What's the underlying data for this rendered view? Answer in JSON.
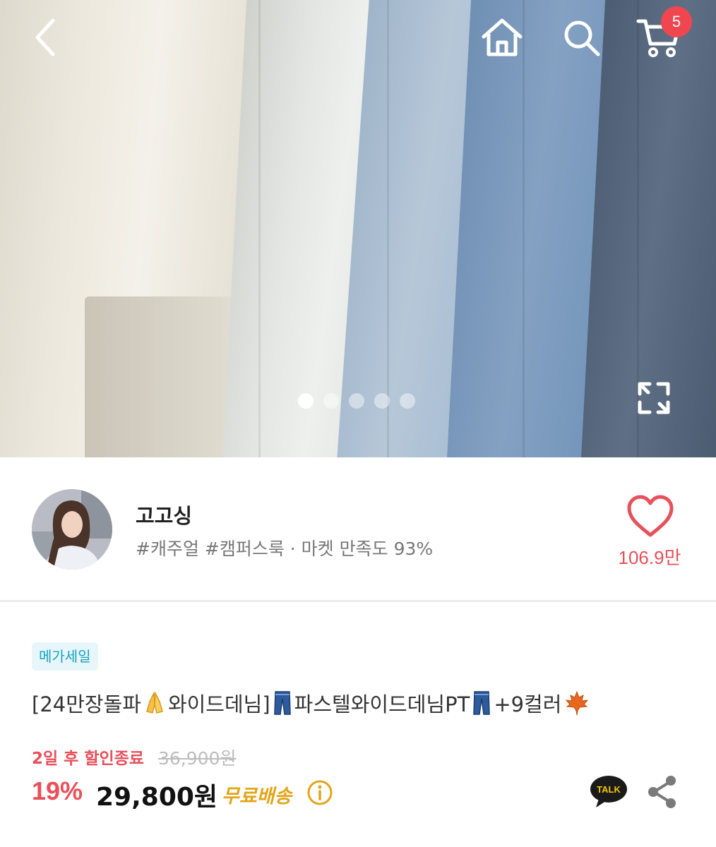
{
  "header": {
    "icons": [
      "back-icon",
      "home-icon",
      "search-icon",
      "cart-icon"
    ],
    "cart_badge": "5"
  },
  "gallery": {
    "slide_count": 5,
    "active_slide": 1,
    "icon": "expand-icon"
  },
  "shop": {
    "name": "고고싱",
    "tags": "#캐주얼 #캠퍼스룩 · 마켓 만족도 93%",
    "like_count": "106.9만",
    "accent_color": "#e8505b"
  },
  "product": {
    "badge": "메가세일",
    "title_parts": [
      "[24만장돌파",
      "와이드데님]",
      "파스텔와이드데님PT",
      "+9컬러"
    ],
    "title_emojis": [
      "folded-hands-emoji",
      "jeans-emoji",
      "jeans-emoji",
      "maple-leaf-emoji"
    ],
    "discount_end": "2일 후 할인종료",
    "original_price": "36,900원",
    "discount_rate": "19%",
    "price": "29,800원",
    "shipping": "무료배송",
    "talk_label": "TALK"
  },
  "colors": {
    "discount": "#e8505b",
    "shipping": "#e3a417",
    "badge_text": "#18a3bd",
    "badge_bg": "#e6f6fa",
    "cart_badge": "#f0464f"
  }
}
